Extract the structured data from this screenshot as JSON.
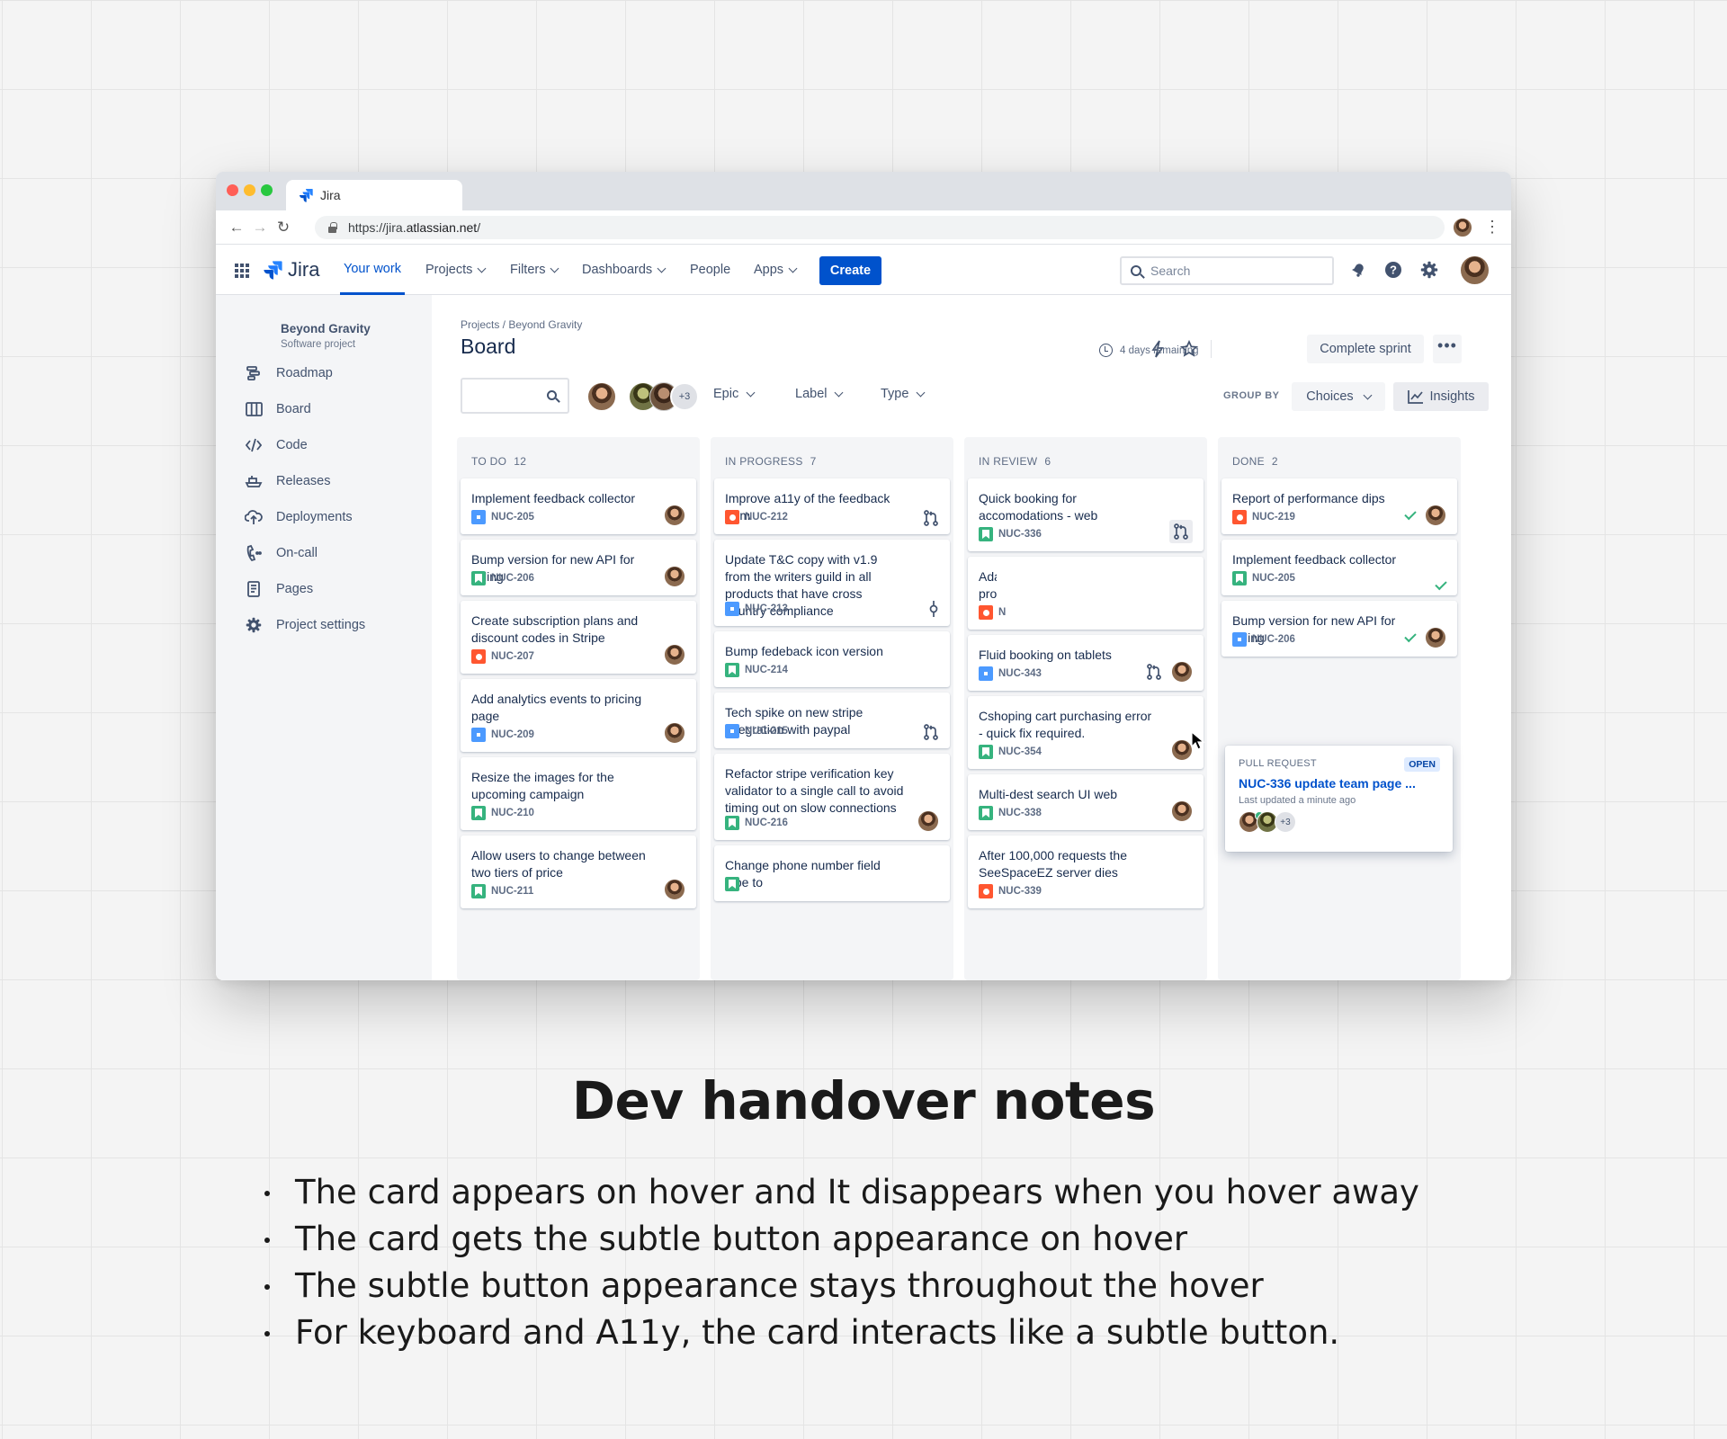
{
  "browser": {
    "tab_title": "Jira",
    "url_prefix": "https://jira.",
    "url_host": "atlassian.net",
    "url_suffix": "/"
  },
  "topnav": {
    "brand": "Jira",
    "items": [
      "Your work",
      "Projects",
      "Filters",
      "Dashboards",
      "People",
      "Apps"
    ],
    "create": "Create",
    "search_placeholder": "Search"
  },
  "sidebar": {
    "project_name": "Beyond Gravity",
    "project_type": "Software project",
    "items": [
      {
        "label": "Roadmap",
        "icon": "roadmap-icon"
      },
      {
        "label": "Board",
        "icon": "board-icon"
      },
      {
        "label": "Code",
        "icon": "code-icon"
      },
      {
        "label": "Releases",
        "icon": "releases-icon"
      },
      {
        "label": "Deployments",
        "icon": "deployments-icon"
      },
      {
        "label": "On-call",
        "icon": "on-call-icon"
      },
      {
        "label": "Pages",
        "icon": "pages-icon"
      },
      {
        "label": "Project settings",
        "icon": "gear-icon"
      }
    ]
  },
  "board": {
    "breadcrumb": "Projects / Beyond Gravity",
    "title": "Board",
    "remaining": "4 days remaining",
    "complete_sprint": "Complete sprint",
    "filters": {
      "more_avatars": "+3",
      "epic": "Epic",
      "label": "Label",
      "type": "Type",
      "group_by": "GROUP BY",
      "choices": "Choices",
      "insights": "Insights"
    },
    "columns": [
      {
        "name": "TO DO",
        "count": "12",
        "cards": [
          {
            "title": "Implement feedback collector",
            "key": "NUC-205",
            "type": "task"
          },
          {
            "title": "Bump version for new API for billing",
            "key": "NUC-206",
            "type": "story"
          },
          {
            "title": "Create subscription plans and discount codes in Stripe",
            "key": "NUC-207",
            "type": "bug"
          },
          {
            "title": "Add analytics events to pricing page",
            "key": "NUC-209",
            "type": "task"
          },
          {
            "title": "Resize the images for the upcoming campaign",
            "key": "NUC-210",
            "type": "story"
          },
          {
            "title": "Allow users to change between two tiers of price",
            "key": "NUC-211",
            "type": "story"
          }
        ]
      },
      {
        "name": "IN PROGRESS",
        "count": "7",
        "cards": [
          {
            "title": "Improve a11y of the feedback form",
            "key": "NUC-212",
            "type": "bug"
          },
          {
            "title": "Update T&C copy with v1.9 from the writers guild in all products that have cross country compliance",
            "key": "NUC-213",
            "type": "task"
          },
          {
            "title": "Bump fedeback icon version",
            "key": "NUC-214",
            "type": "story"
          },
          {
            "title": "Tech spike on new stripe integration with paypal",
            "key": "NUC-215",
            "type": "task"
          },
          {
            "title": "Refactor stripe verification key validator to a single call to avoid timing out on slow connections",
            "key": "NUC-216",
            "type": "story"
          },
          {
            "title": "Change phone number field type to",
            "key": "",
            "type": "story"
          }
        ]
      },
      {
        "name": "IN REVIEW",
        "count": "6",
        "cards": [
          {
            "title": "Quick booking for accomodations - web",
            "key": "NUC-336",
            "type": "story"
          },
          {
            "title": "Ada",
            "title2": "prov",
            "key": "N",
            "type": "bug"
          },
          {
            "title": "Fluid booking on tablets",
            "key": "NUC-343",
            "type": "task"
          },
          {
            "title": "Cshoping cart purchasing error - quick fix required.",
            "key": "NUC-354",
            "type": "story"
          },
          {
            "title": "Multi-dest search UI web",
            "key": "NUC-338",
            "type": "story"
          },
          {
            "title": "After 100,000 requests the SeeSpaceEZ server dies",
            "key": "NUC-339",
            "type": "bug"
          }
        ]
      },
      {
        "name": "DONE",
        "count": "2",
        "cards": [
          {
            "title": "Report of performance dips",
            "key": "NUC-219",
            "type": "bug"
          },
          {
            "title": "Implement feedback collector",
            "key": "NUC-205",
            "type": "story"
          },
          {
            "title": "Bump version for new API for billing",
            "key": "NUC-206",
            "type": "task"
          }
        ]
      }
    ],
    "popup": {
      "label": "PULL REQUEST",
      "status": "OPEN",
      "title": "NUC-336 update team page ...",
      "updated": "Last updated a minute ago",
      "more": "+3"
    }
  },
  "caption": {
    "heading": "Dev handover notes",
    "notes": [
      "The card appears on hover and It disappears when you hover away",
      "The card gets the subtle button appearance on hover",
      "The subtle button appearance stays throughout the hover",
      "For keyboard and A11y, the card interacts like a subtle button."
    ]
  },
  "colors": {
    "primary": "#0052CC",
    "task": "#4C9AFF",
    "story": "#36B37E",
    "bug": "#FF5630"
  }
}
